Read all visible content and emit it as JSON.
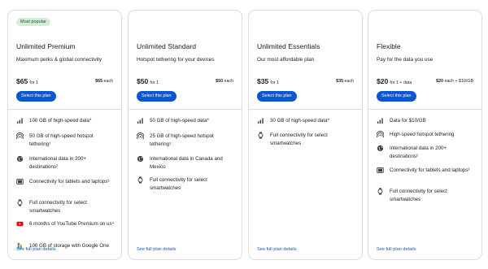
{
  "plans": [
    {
      "badge": "Most popular",
      "title": "Unlimited Premium",
      "subtitle": "Maximum perks & global connectivity",
      "price": "$65",
      "price_suffix": "for 1",
      "each_price": "$65",
      "each_suffix": "each",
      "button": "Select this plan",
      "link": "See full plan details",
      "features": [
        {
          "icon": "signal-bars-icon",
          "text": "100 GB of high-speed data*"
        },
        {
          "icon": "hotspot-icon",
          "text": "50 GB of high-speed hotspot tethering¹"
        },
        {
          "icon": "globe-icon",
          "text": "International data in 200+ destinations²"
        },
        {
          "icon": "tablet-icon",
          "text": "Connectivity for tablets and laptops³"
        },
        {
          "icon": "smartwatch-icon",
          "text": "Full connectivity for select smartwatches"
        },
        {
          "icon": "youtube-icon",
          "text": "6 months of YouTube Premium on us⁴"
        },
        {
          "icon": "google-one-icon",
          "text": "100 GB of storage with Google One"
        }
      ]
    },
    {
      "title": "Unlimited Standard",
      "subtitle": "Hotspot tethering for your devices",
      "price": "$50",
      "price_suffix": "for 1",
      "each_price": "$50",
      "each_suffix": "each",
      "button": "Select this plan",
      "link": "See full plan details",
      "features": [
        {
          "icon": "signal-bars-icon",
          "text": "50 GB of high-speed data*"
        },
        {
          "icon": "hotspot-icon",
          "text": "25 GB of high-speed hotspot tethering¹"
        },
        {
          "icon": "globe-icon",
          "text": "International data in Canada and Mexico"
        },
        {
          "icon": "smartwatch-icon",
          "text": "Full connectivity for select smartwatches"
        }
      ]
    },
    {
      "title": "Unlimited Essentials",
      "subtitle": "Our most affordable plan",
      "price": "$35",
      "price_suffix": "for 1",
      "each_price": "$35",
      "each_suffix": "each",
      "button": "Select this plan",
      "link": "See full plan details",
      "features": [
        {
          "icon": "signal-bars-icon",
          "text": "30 GB of high-speed data*"
        },
        {
          "icon": "smartwatch-icon",
          "text": "Full connectivity for select smartwatches"
        }
      ]
    },
    {
      "title": "Flexible",
      "subtitle": "Pay for the data you use",
      "price": "$20",
      "price_suffix": "for 1 + data",
      "each_price": "$20",
      "each_suffix": "each + $10/GB",
      "button": "Select this plan",
      "link": "See full plan details",
      "features": [
        {
          "icon": "signal-bars-icon",
          "text": "Data for $10/GB"
        },
        {
          "icon": "hotspot-icon",
          "text": "High-speed hotspot tethering"
        },
        {
          "icon": "globe-icon",
          "text": "International data in 200+ destinations²"
        },
        {
          "icon": "tablet-icon",
          "text": "Connectivity for tablets and laptops³"
        },
        {
          "icon": "smartwatch-icon",
          "text": "Full connectivity for select smartwatches"
        }
      ]
    }
  ],
  "colors": {
    "accent": "#0b57d0",
    "badge_bg": "#d4ecd8",
    "badge_text": "#15582a",
    "youtube": "#ff0000"
  }
}
